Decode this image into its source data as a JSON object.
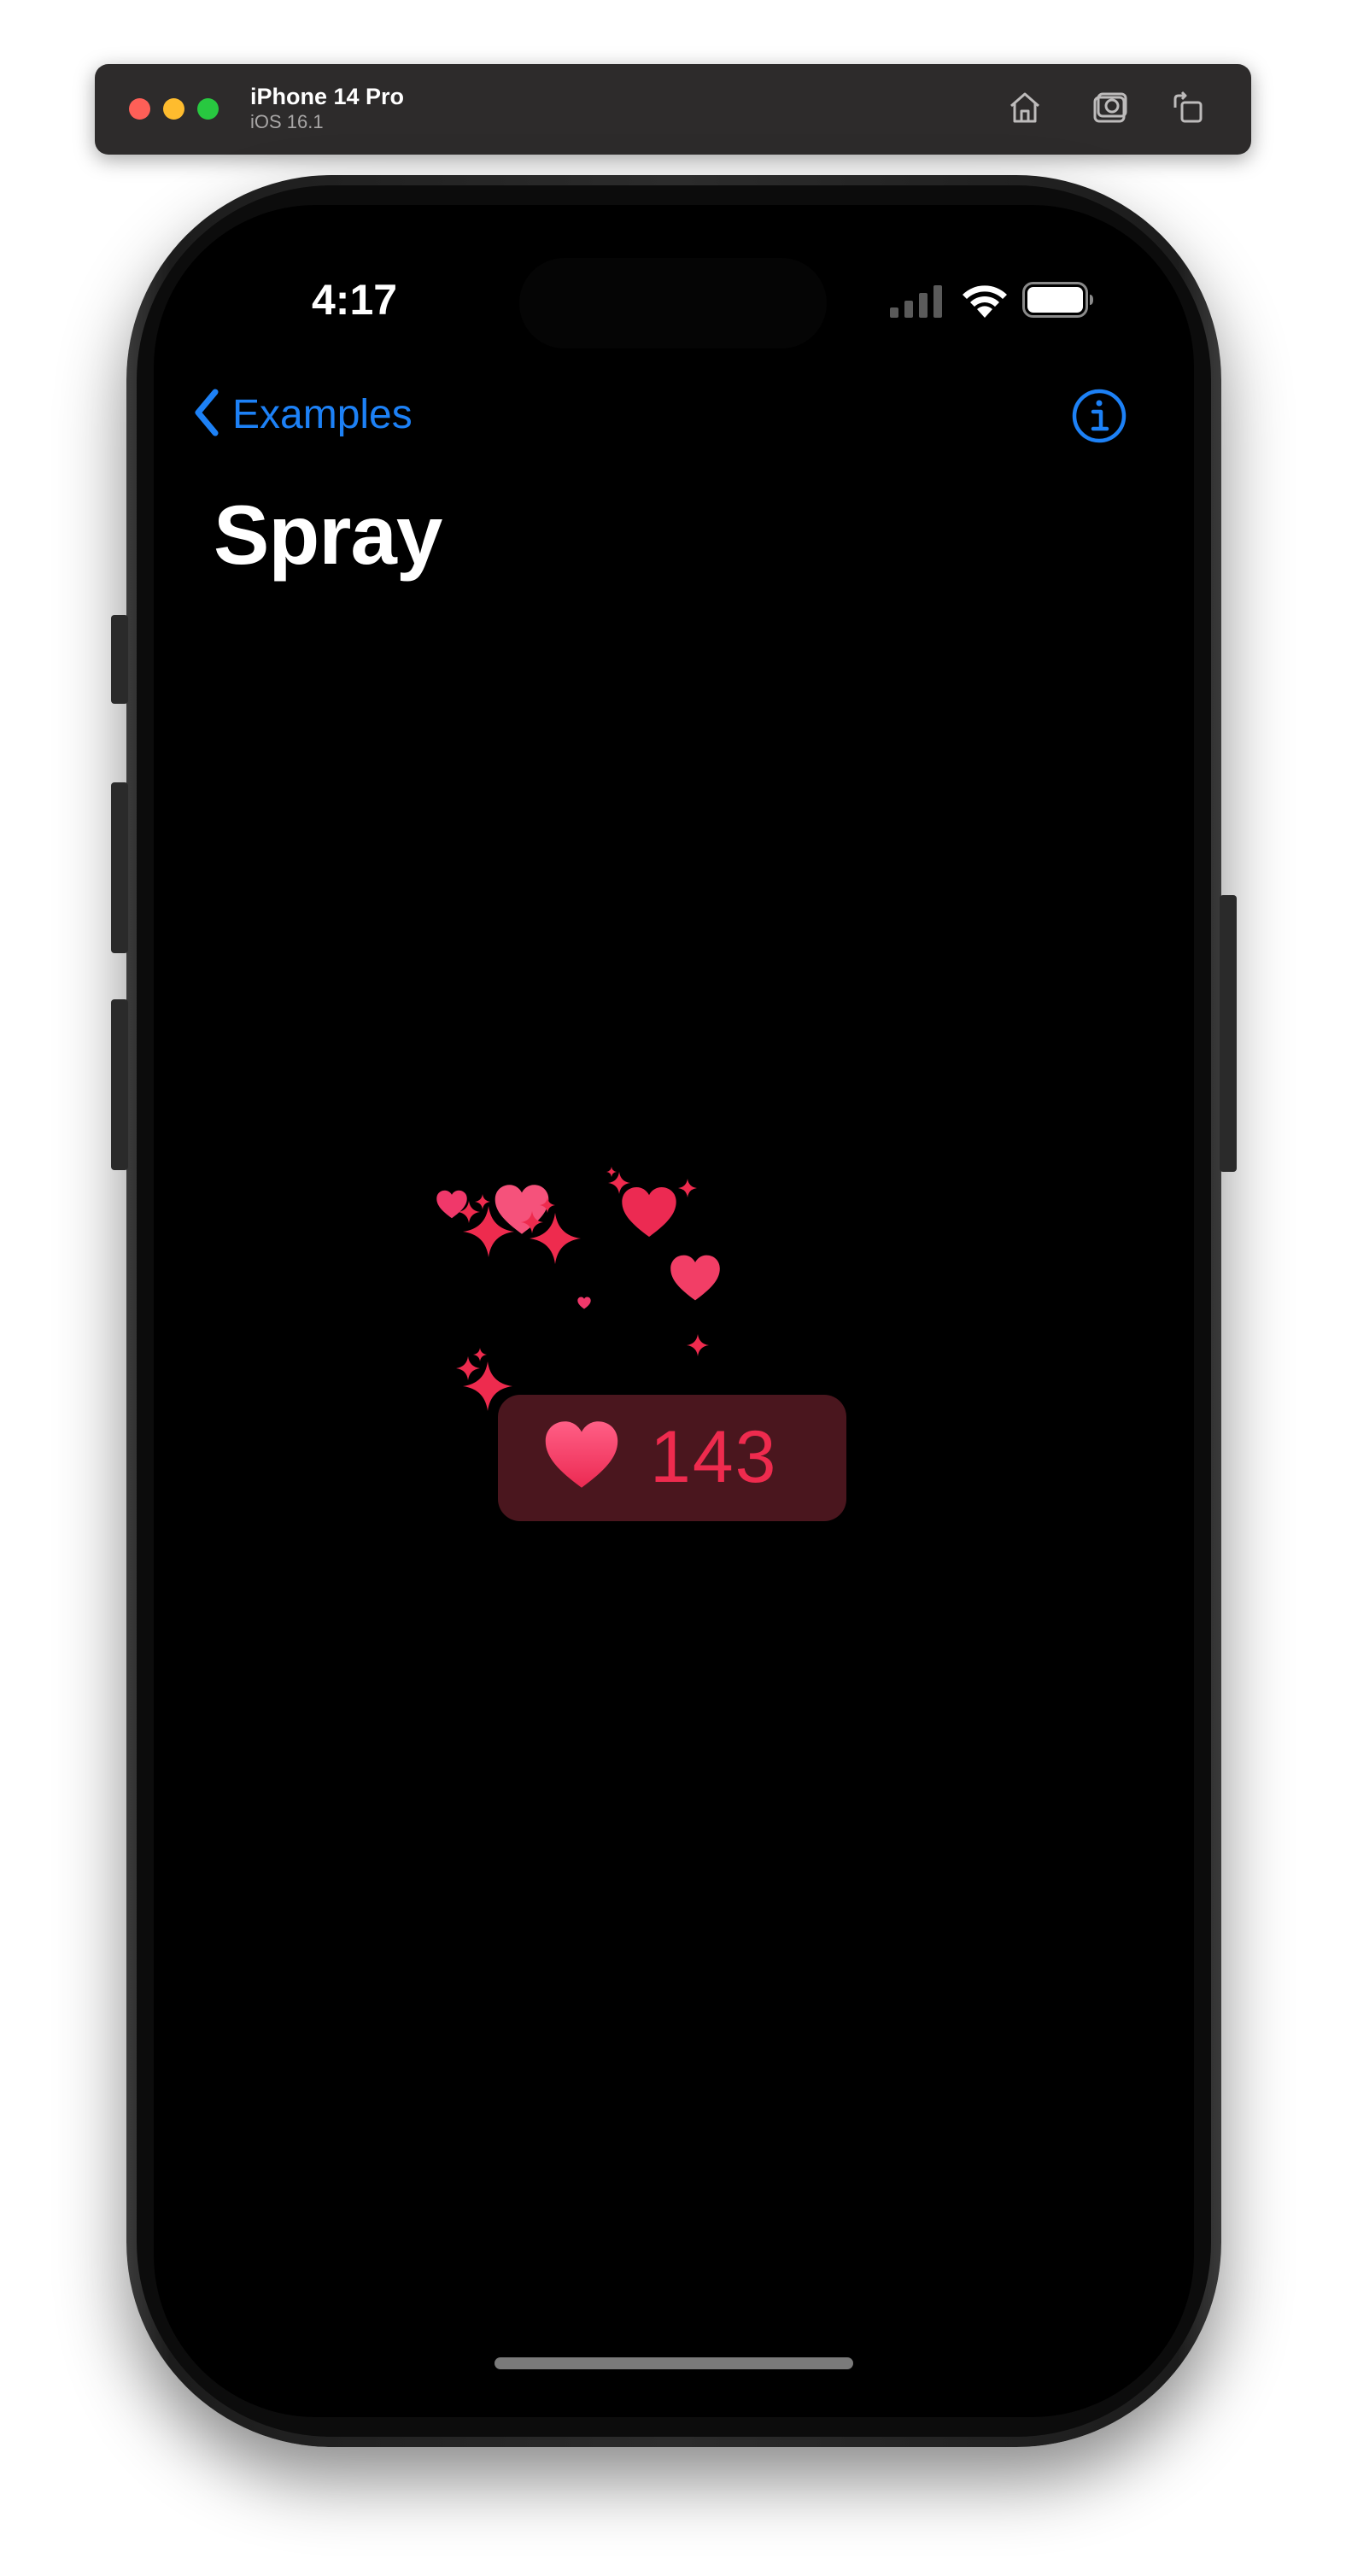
{
  "simulator": {
    "device_name": "iPhone 14 Pro",
    "os_version": "iOS 16.1",
    "toolbar_icons": [
      "home-icon",
      "screenshot-icon",
      "rotate-icon"
    ]
  },
  "status_bar": {
    "time": "4:17",
    "icons": [
      "cellular-signal-icon",
      "wifi-icon",
      "battery-icon"
    ]
  },
  "nav_bar": {
    "back_label": "Examples",
    "back_icon": "chevron-left-icon",
    "info_icon": "info-circle-icon",
    "accent_color": "#1d81f6"
  },
  "page": {
    "title": "Spray"
  },
  "like_button": {
    "count": "143",
    "icon": "heart-icon",
    "color": "#ee2b4e",
    "background": "#4a161e"
  },
  "effects": {
    "particle_icons": [
      "heart-icon",
      "sparkle-icon"
    ]
  }
}
